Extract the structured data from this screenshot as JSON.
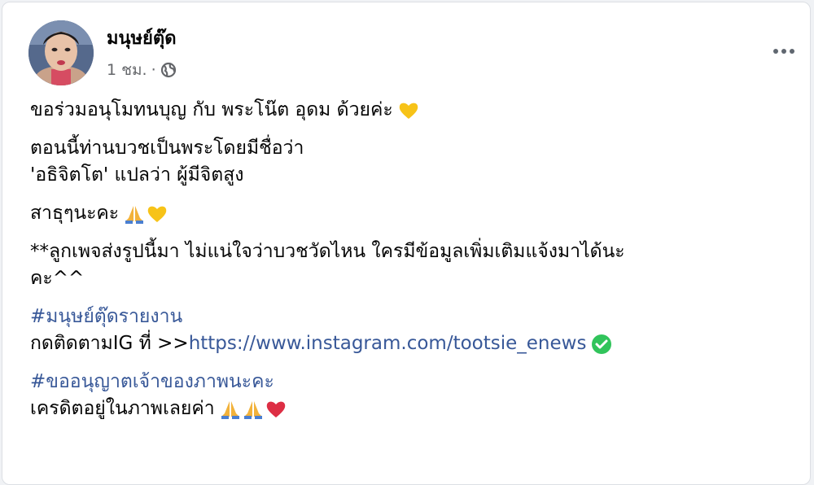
{
  "post": {
    "author": "มนุษย์ตุ๊ด",
    "timestamp": "1 ชม.",
    "separator": "·",
    "privacy_icon": "globe-icon",
    "menu_icon": "more-dots-icon",
    "lines": {
      "l1": "ขอร่วมอนุโมทนบุญ กับ พระโน๊ต อุดม ด้วยค่ะ",
      "l2": "ตอนนี้ท่านบวชเป็นพระโดยมีชื่อว่า",
      "l3": "'อธิจิตโต' แปลว่า ผู้มีจิตสูง",
      "l4": "สาธุๆนะคะ",
      "l5": "**ลูกเพจส่งรูปนี้มา ไม่แน่ใจว่าบวชวัดไหน ใครมีข้อมูลเพิ่มเติมแจ้งมาได้นะ",
      "l6": "คะ^^",
      "hashtag1": "#มนุษย์ตุ๊ดรายงาน",
      "follow_prefix": "กดติดตามIG ที่ >>",
      "follow_link": "https://www.instagram.com/tootsie_enews",
      "hashtag2": "#ขออนุญาตเจ้าของภาพนะคะ",
      "credit": "เครดิตอยู่ในภาพเลยค่า"
    },
    "emoji_icons": [
      "yellow-heart-icon",
      "folded-hands-icon",
      "check-mark-icon",
      "red-heart-icon"
    ],
    "colors": {
      "link": "#385898",
      "text": "#050505",
      "meta": "#65676b",
      "yellow_heart": "#f7c318",
      "red_heart": "#dd2e44",
      "check": "#31c45b"
    }
  }
}
